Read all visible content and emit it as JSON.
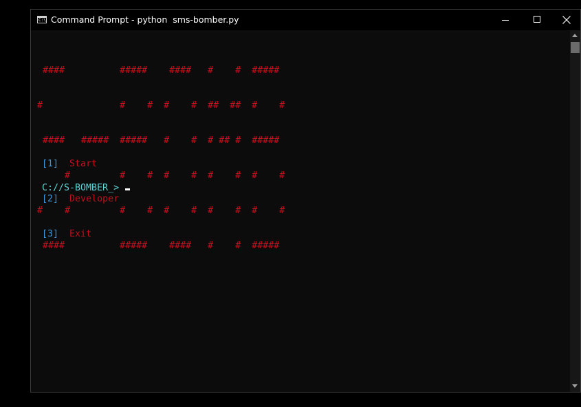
{
  "window": {
    "title": "Command Prompt - python  sms-bomber.py",
    "icon": "cmd-icon",
    "icon_text": "C:\\",
    "controls": {
      "minimize_icon": "minimize-icon",
      "maximize_icon": "maximize-icon",
      "close_icon": "close-icon"
    }
  },
  "banner": {
    "color": "#c50f1f",
    "lines": [
      " ####          #####    ####   #    #  #####",
      "#              #    #  #    #  ##  ##  #    #",
      " ####   #####  #####   #    #  # ## #  #####",
      "     #         #    #  #    #  #    #  #    #",
      "#    #         #    #  #    #  #    #  #    #",
      " ####          #####    ####   #    #  #####"
    ]
  },
  "menu": {
    "key_color": "#3a96dd",
    "label_color": "#c50f1f",
    "items": [
      {
        "key": "[1]",
        "label": "Start"
      },
      {
        "key": "[2]",
        "label": "Developer"
      },
      {
        "key": "[3]",
        "label": "Exit"
      }
    ]
  },
  "prompt": {
    "text": "C://S-BOMBER_> ",
    "color": "#61d6d6",
    "input_value": ""
  },
  "colors": {
    "background": "#0c0c0c",
    "titlebar": "#000000"
  }
}
